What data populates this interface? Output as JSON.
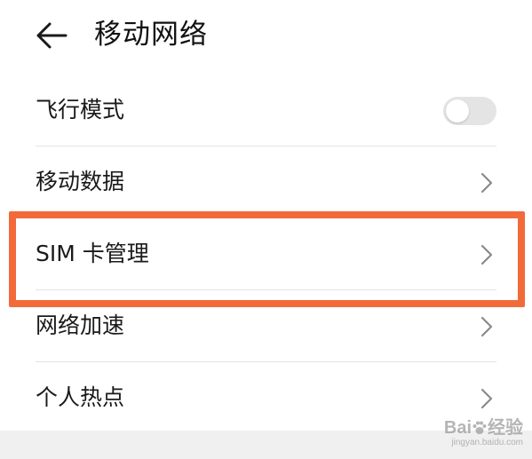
{
  "header": {
    "title": "移动网络",
    "back_icon": "arrow-left-icon"
  },
  "settings": [
    {
      "label": "飞行模式",
      "control": "toggle",
      "toggle_on": false
    },
    {
      "label": "移动数据",
      "control": "chevron"
    },
    {
      "label": "SIM 卡管理",
      "control": "chevron",
      "highlighted": true
    },
    {
      "label": "网络加速",
      "control": "chevron"
    },
    {
      "label": "个人热点",
      "control": "chevron"
    }
  ],
  "highlight_color": "#f26a3a",
  "watermark": {
    "logo_prefix": "Bai",
    "logo_suffix": "经验",
    "url": "jingyan.baidu.com"
  }
}
